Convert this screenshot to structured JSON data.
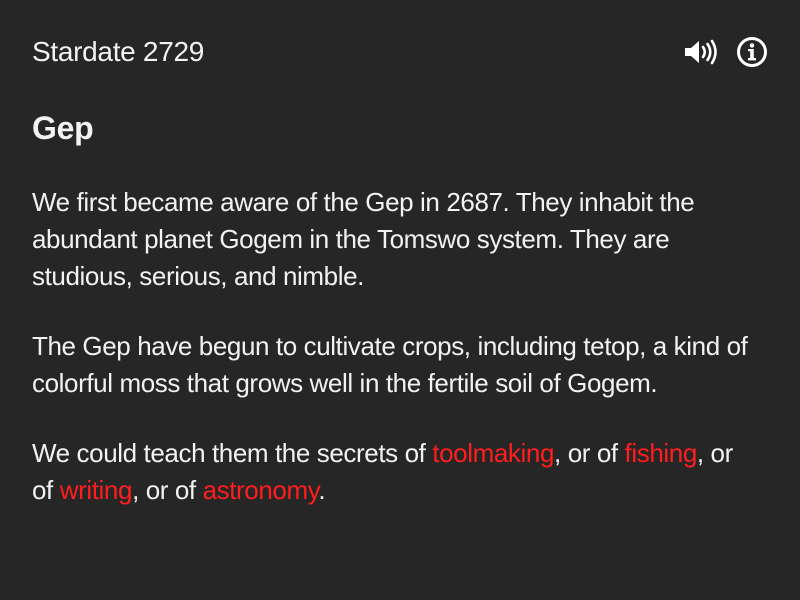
{
  "header": {
    "stardate": "Stardate 2729",
    "speaker_icon": "speaker-icon",
    "info_icon": "info-icon"
  },
  "title": "Gep",
  "paragraphs": [
    "We first became aware of the Gep in 2687. They inhabit the abundant planet Gogem in the Tomswo system. They are studious, serious, and nimble.",
    "The Gep have begun to cultivate crops, including tetop, a kind of colorful moss that grows well in the fertile soil of Gogem."
  ],
  "choices": {
    "prefix": "We could teach them the secrets of ",
    "sep1": ", or of ",
    "sep2": ", or of ",
    "sep3": ", or of ",
    "suffix": ".",
    "options": [
      "toolmaking",
      "fishing",
      "writing",
      "astronomy"
    ]
  },
  "colors": {
    "background": "#262626",
    "text": "#f2f2f2",
    "link": "#ff1d1d"
  }
}
